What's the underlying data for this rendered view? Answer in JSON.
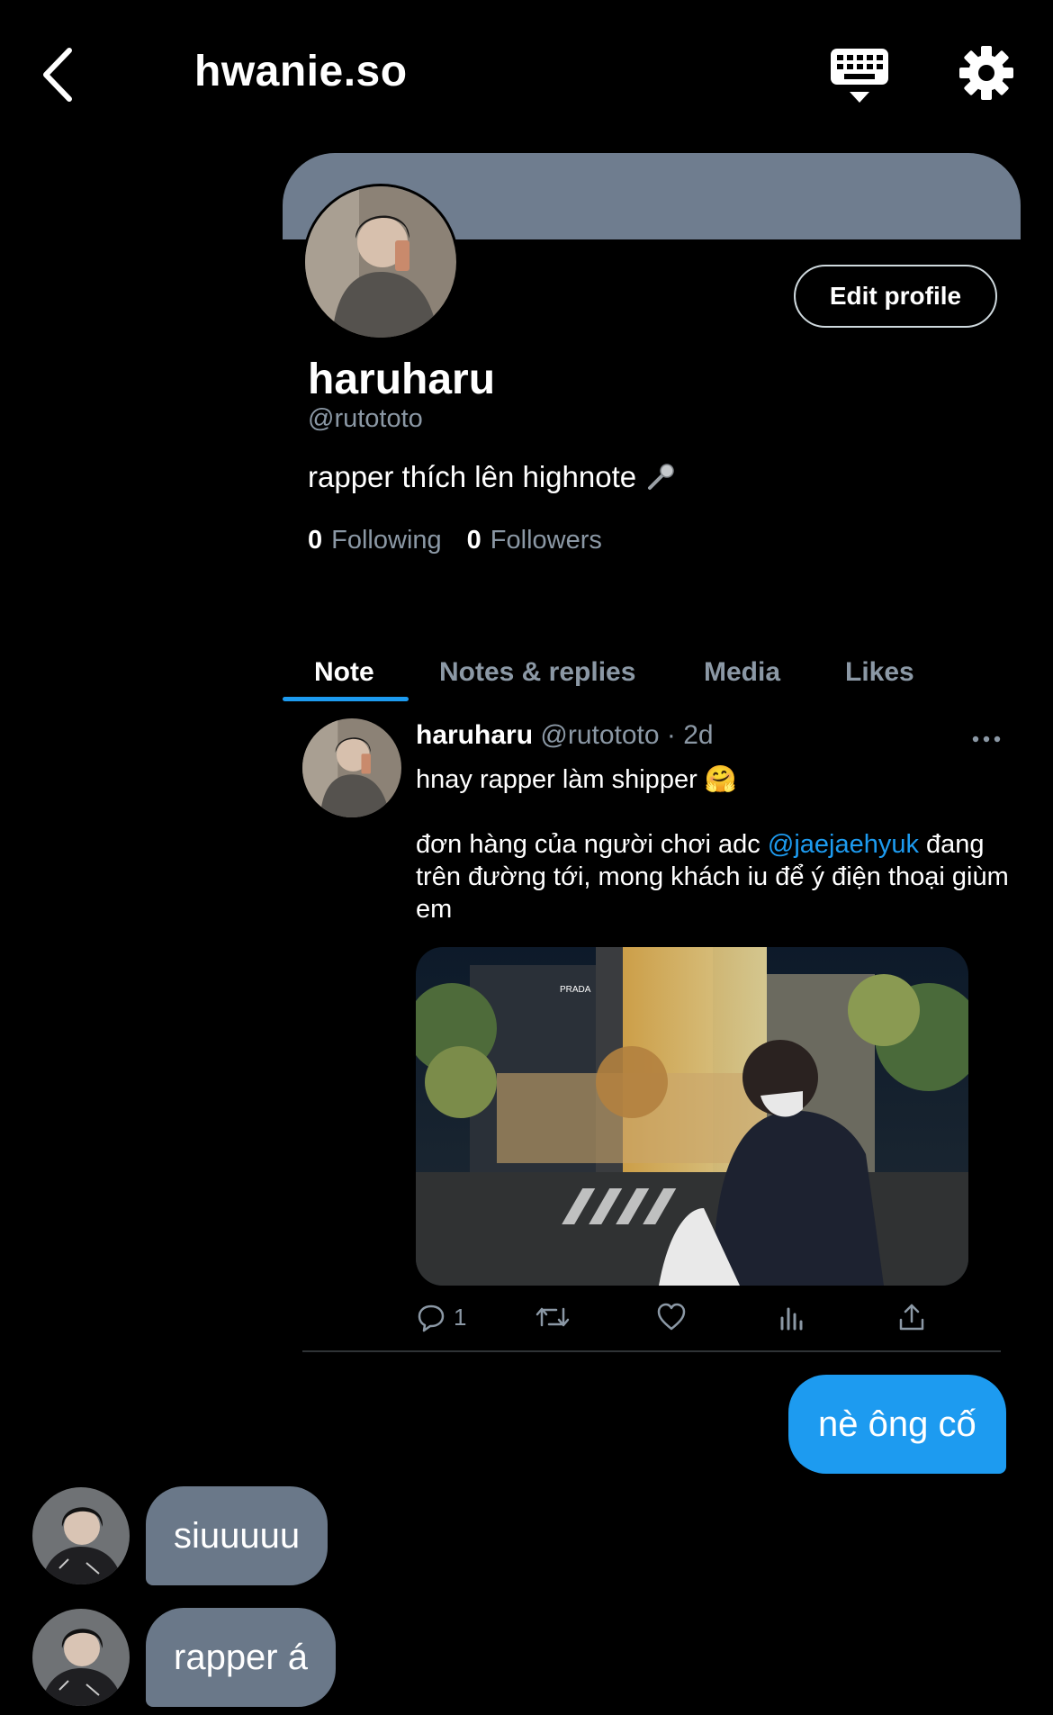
{
  "colors": {
    "accent": "#1d9bf0",
    "banner": "#6f7d8f",
    "secondary_text": "#8b98a5",
    "received_bubble": "#6a7889",
    "background": "#000000"
  },
  "header": {
    "title": "hwanie.so",
    "back_icon": "chevron-left-icon",
    "keyboard_icon": "keyboard-icon",
    "settings_icon": "gear-icon"
  },
  "profile": {
    "display_name": "haruharu",
    "handle": "@rutototo",
    "bio": "rapper thích lên highnote",
    "bio_icon": "microphone-icon",
    "edit_label": "Edit profile",
    "following_count": "0",
    "following_label": "Following",
    "followers_count": "0",
    "followers_label": "Followers"
  },
  "tabs": [
    {
      "label": "Note",
      "active": true
    },
    {
      "label": "Notes & replies",
      "active": false
    },
    {
      "label": "Media",
      "active": false
    },
    {
      "label": "Likes",
      "active": false
    }
  ],
  "note": {
    "author": "haruharu",
    "handle": "@rutototo",
    "separator": "·",
    "time": "2d",
    "line1": "hnay rapper làm shipper",
    "line1_emoji": "🤗",
    "line2_prefix": "đơn hàng của người chơi adc",
    "mention": "@jaejaehyuk",
    "line2_suffix": "đang trên đường tới, mong khách iu để ý điện thoại giùm em",
    "reply_count": "1",
    "image_desc": "night street photo",
    "image_sign": "PRADA",
    "more_icon": "more-horizontal-icon",
    "action_icons": [
      "reply-icon",
      "retweet-icon",
      "heart-icon",
      "analytics-icon",
      "share-icon"
    ]
  },
  "chat": {
    "sent": "nè ông cố",
    "received": [
      "siuuuuu",
      "rapper á"
    ]
  }
}
